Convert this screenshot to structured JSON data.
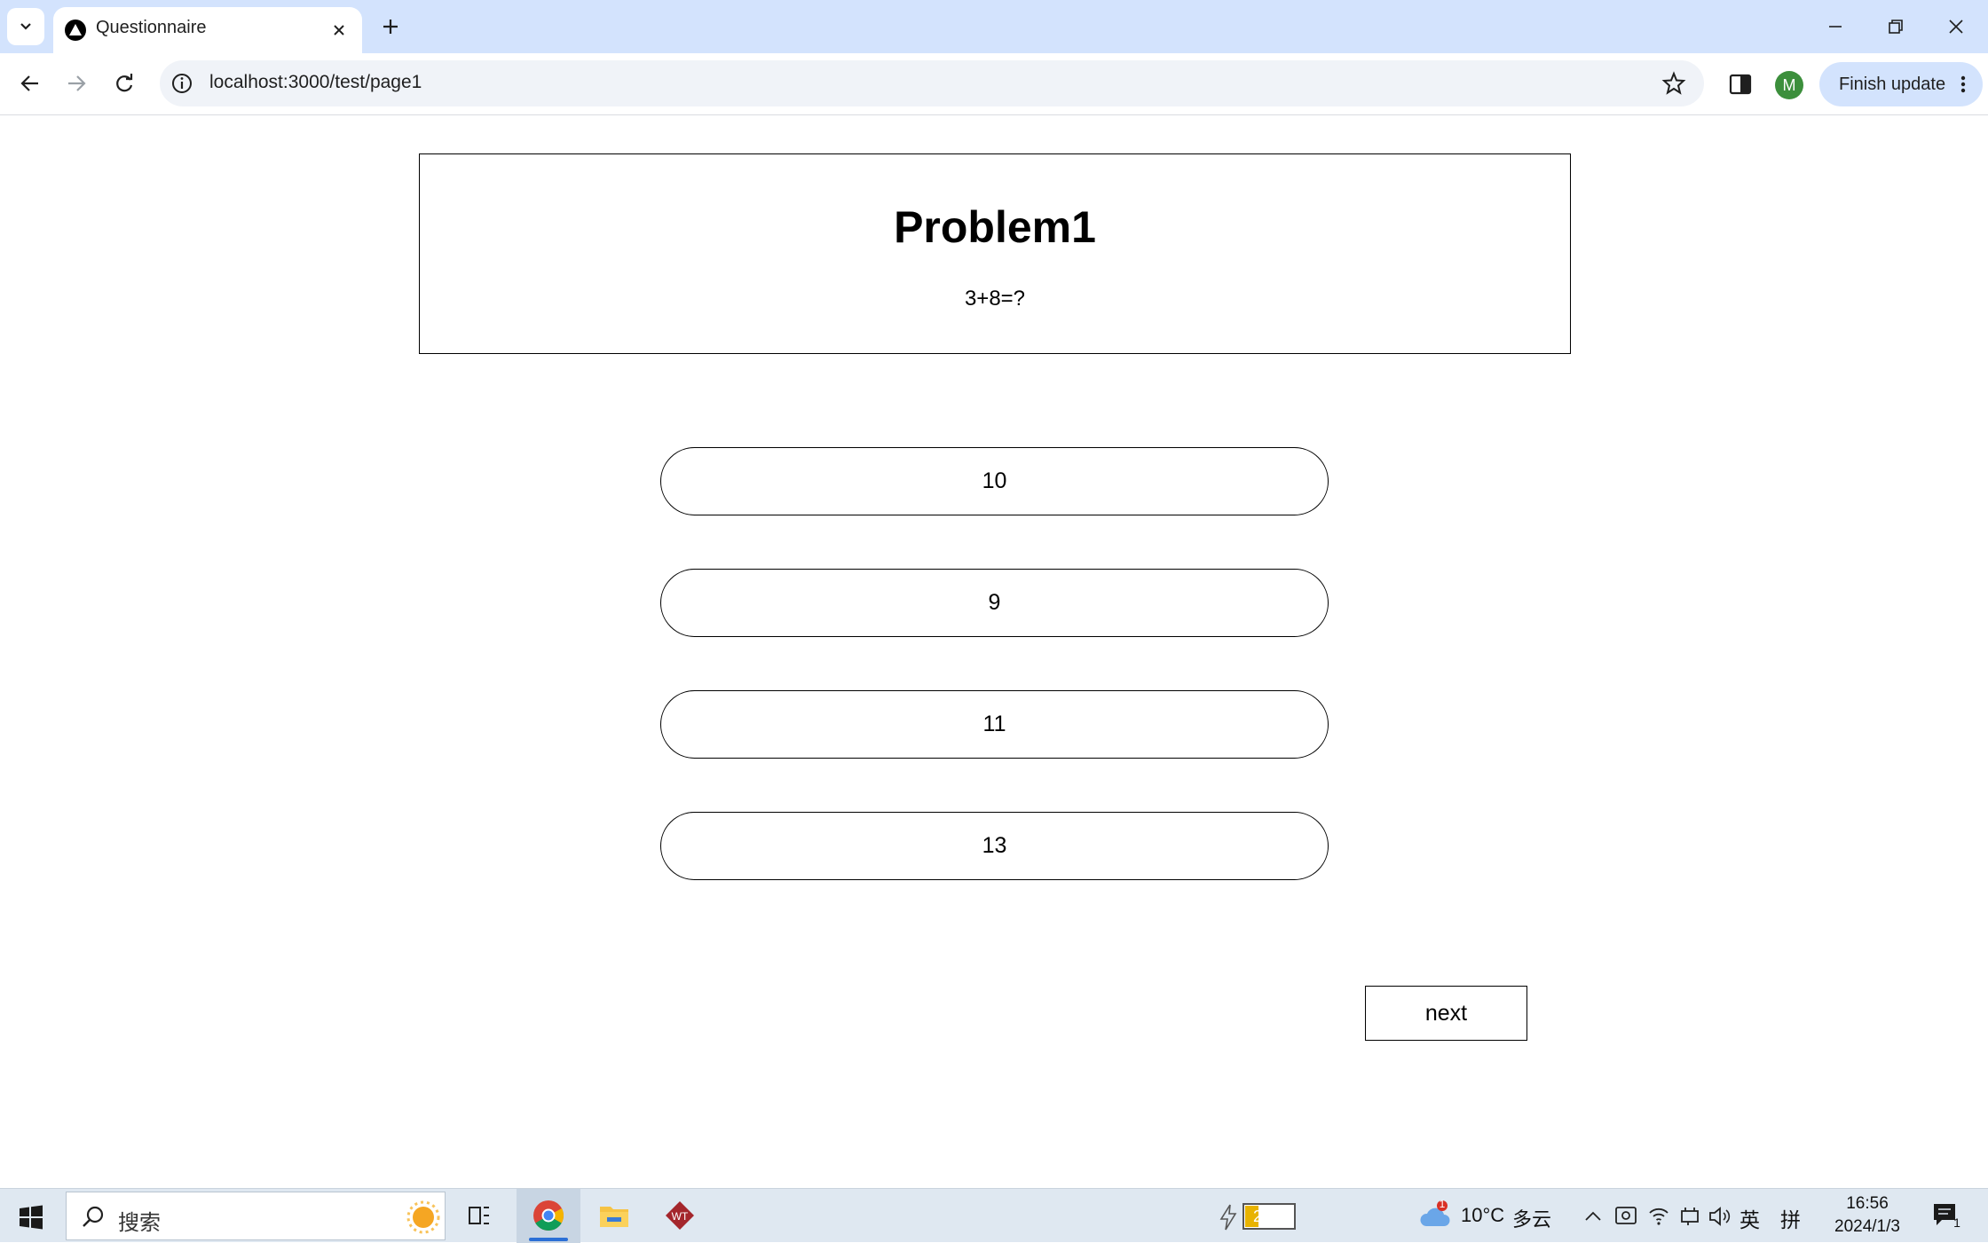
{
  "browser": {
    "tab": {
      "title": "Questionnaire"
    },
    "address_bar": {
      "url": "localhost:3000/test/page1"
    },
    "profile_initial": "M",
    "finish_update_label": "Finish update"
  },
  "page": {
    "problem": {
      "title": "Problem1",
      "question": "3+8=?"
    },
    "options": [
      {
        "label": "10"
      },
      {
        "label": "9"
      },
      {
        "label": "11"
      },
      {
        "label": "13"
      }
    ],
    "next_label": "next"
  },
  "taskbar": {
    "search_placeholder": "搜索",
    "battery_percent": "27%",
    "battery_level": 0.27,
    "weather": {
      "temp": "10°C",
      "condition": "多云",
      "badge": "1"
    },
    "ime": {
      "lang": "英",
      "mode": "拼"
    },
    "clock": {
      "time": "16:56",
      "date": "2024/1/3"
    },
    "notification_count": "1"
  },
  "colors": {
    "tabstrip_bg": "#d3e3fd",
    "accent": "#2b6fd6",
    "avatar_bg": "#3c8f3c",
    "battery_fill": "#e8b300"
  }
}
